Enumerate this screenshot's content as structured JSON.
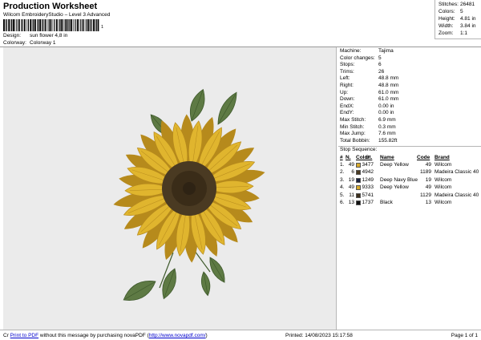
{
  "header": {
    "title": "Production Worksheet",
    "subtitle": "Wilcom EmbroideryStudio – Level 3 Advanced",
    "barcode_number": "1",
    "design_label": "Design:",
    "design_value": "sun flower 4,8 in",
    "colorway_label": "Colorway:",
    "colorway_value": "Colorway 1"
  },
  "stats": {
    "stitches_label": "Stitches:",
    "stitches": "26481",
    "colors_label": "Colors:",
    "colors": "5",
    "height_label": "Height:",
    "height": "4.81 in",
    "width_label": "Width:",
    "width": "3.84 in",
    "zoom_label": "Zoom:",
    "zoom": "1:1"
  },
  "info": [
    {
      "label": "Machine:",
      "value": "Tajima"
    },
    {
      "label": "Color changes:",
      "value": "5"
    },
    {
      "label": "Stops:",
      "value": "6"
    },
    {
      "label": "Trims:",
      "value": "26"
    },
    {
      "label": "Left:",
      "value": "48.8 mm"
    },
    {
      "label": "Right:",
      "value": "48.8 mm"
    },
    {
      "label": "Up:",
      "value": "61.0 mm"
    },
    {
      "label": "Down:",
      "value": "61.0 mm"
    },
    {
      "label": "EndX:",
      "value": "0.00 in"
    },
    {
      "label": "EndY:",
      "value": "0.00 in"
    },
    {
      "label": "Max Stitch:",
      "value": "6.9 mm"
    },
    {
      "label": "Min Stitch:",
      "value": "0.3 mm"
    },
    {
      "label": "Max Jump:",
      "value": "7.6 mm"
    },
    {
      "label": "Total Bobbin:",
      "value": "155.82ft"
    }
  ],
  "stop_sequence": {
    "title": "Stop Sequence:",
    "headers": {
      "num": "#",
      "n": "N.",
      "color": "Color",
      "st": "St.",
      "name": "Name",
      "code": "Code",
      "brand": "Brand"
    },
    "rows": [
      {
        "num": "1.",
        "n": "49",
        "color": "#d8aa2c",
        "st": "3477",
        "name": "Deep Yellow",
        "code": "49",
        "brand": "Wilcom"
      },
      {
        "num": "2.",
        "n": "6",
        "color": "#4a3a22",
        "st": "4942",
        "name": "",
        "code": "1189",
        "brand": "Madeira Classic 40"
      },
      {
        "num": "3.",
        "n": "19",
        "color": "#1a2240",
        "st": "1249",
        "name": "Deep Navy Blue",
        "code": "19",
        "brand": "Wilcom"
      },
      {
        "num": "4.",
        "n": "49",
        "color": "#d8aa2c",
        "st": "9333",
        "name": "Deep Yellow",
        "code": "49",
        "brand": "Wilcom"
      },
      {
        "num": "5.",
        "n": "11",
        "color": "#3b2e1c",
        "st": "5741",
        "name": "",
        "code": "1129",
        "brand": "Madeira Classic 40"
      },
      {
        "num": "6.",
        "n": "13",
        "color": "#111111",
        "st": "1737",
        "name": "Black",
        "code": "13",
        "brand": "Wilcom"
      }
    ]
  },
  "footer": {
    "prefix": "Cr",
    "link_print": "Print to PDF",
    "message": " without this message by purchasing novaPDF (",
    "link_url": "http://www.novapdf.com/",
    "suffix": ")",
    "printed": "Printed: 14/08/2023 15:17:58",
    "page": "Page 1 of 1"
  },
  "colors": {
    "petal": "#e0b52e",
    "petal_dark": "#b68a1c",
    "center": "#4a3a22",
    "leaf": "#5e7a44",
    "leaf_dark": "#3f5a2c",
    "background": "#ebebeb"
  }
}
